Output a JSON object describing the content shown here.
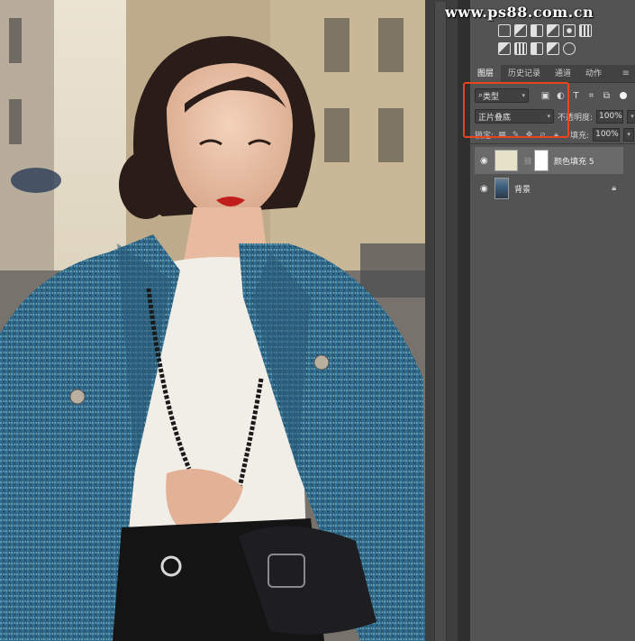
{
  "watermark": "www.ps88.com.cn",
  "tabs": [
    {
      "label": "图层",
      "active": true
    },
    {
      "label": "历史记录",
      "active": false
    },
    {
      "label": "通道",
      "active": false
    },
    {
      "label": "动作",
      "active": false
    }
  ],
  "filter": {
    "kind_label": "类型"
  },
  "blend": {
    "mode": "正片叠底",
    "opacity_label": "不透明度:",
    "opacity_value": "100%"
  },
  "lock": {
    "label": "锁定:",
    "fill_label": "填充:",
    "fill_value": "100%"
  },
  "layers": [
    {
      "name": "颜色填充 5",
      "selected": true,
      "fill_color": "#e6e1c9"
    },
    {
      "name": "背景",
      "selected": false,
      "locked": true
    }
  ],
  "colors": {
    "highlight": "#e94420",
    "panel": "#535353",
    "tab_bar": "#424242"
  },
  "icons": [
    "panel-menu-icon",
    "eye-icon",
    "lock-icon",
    "link-icon",
    "pixel-filter-icon",
    "adjustment-filter-icon",
    "type-filter-icon",
    "shape-filter-icon",
    "smart-object-filter-icon"
  ]
}
